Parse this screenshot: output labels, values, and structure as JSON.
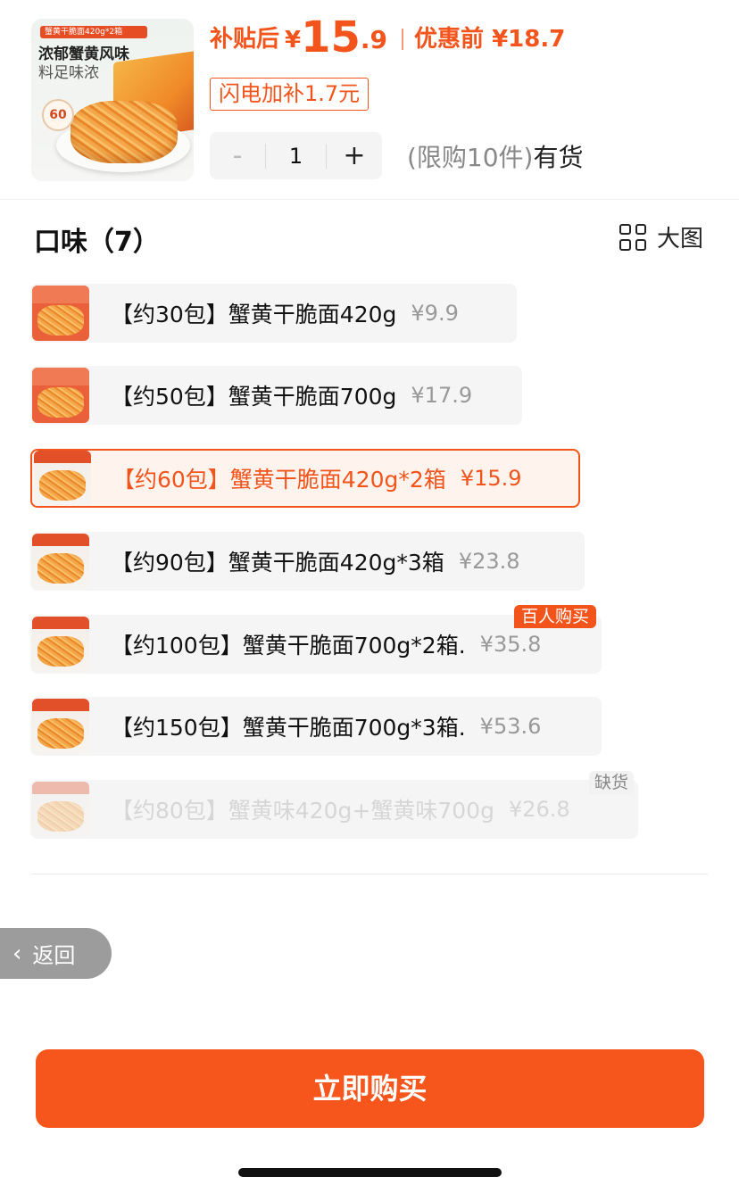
{
  "header": {
    "thumbnail": {
      "banner_text": "蟹黄干脆面420g*2箱",
      "line1": "浓郁蟹黄风味",
      "line2": "料足味浓",
      "badge": "60"
    },
    "price_label": "补贴后",
    "price_currency": "¥",
    "price_int": "15",
    "price_dec": ".9",
    "original_label": "优惠前 ¥18.7",
    "flash_tag": "闪电加补1.7元",
    "stepper": {
      "minus": "-",
      "value": "1",
      "plus": "+"
    },
    "limit_text": "(限购10件)",
    "stock_text": "有货"
  },
  "flavors": {
    "title": "口味（7）",
    "big_view_label": "大图",
    "options": [
      {
        "name": "【约30包】蟹黄干脆面420g",
        "price": "¥9.9",
        "state": "normal"
      },
      {
        "name": "【约50包】蟹黄干脆面700g",
        "price": "¥17.9",
        "state": "normal"
      },
      {
        "name": "【约60包】蟹黄干脆面420g*2箱",
        "price": "¥15.9",
        "state": "selected"
      },
      {
        "name": "【约90包】蟹黄干脆面420g*3箱",
        "price": "¥23.8",
        "state": "normal"
      },
      {
        "name": "【约100包】蟹黄干脆面700g*2箱.",
        "price": "¥35.8",
        "state": "normal",
        "tag": "百人购买"
      },
      {
        "name": "【约150包】蟹黄干脆面700g*3箱.",
        "price": "¥53.6",
        "state": "normal"
      },
      {
        "name": "【约80包】蟹黄味420g+蟹黄味700g",
        "price": "¥26.8",
        "state": "disabled",
        "tag": "缺货"
      }
    ]
  },
  "back_button": {
    "label": "返回"
  },
  "buy_button": {
    "label": "立即购买"
  },
  "colors": {
    "accent": "#f2541b",
    "buy_button": "#f6551c",
    "option_bg": "#f5f5f5"
  }
}
